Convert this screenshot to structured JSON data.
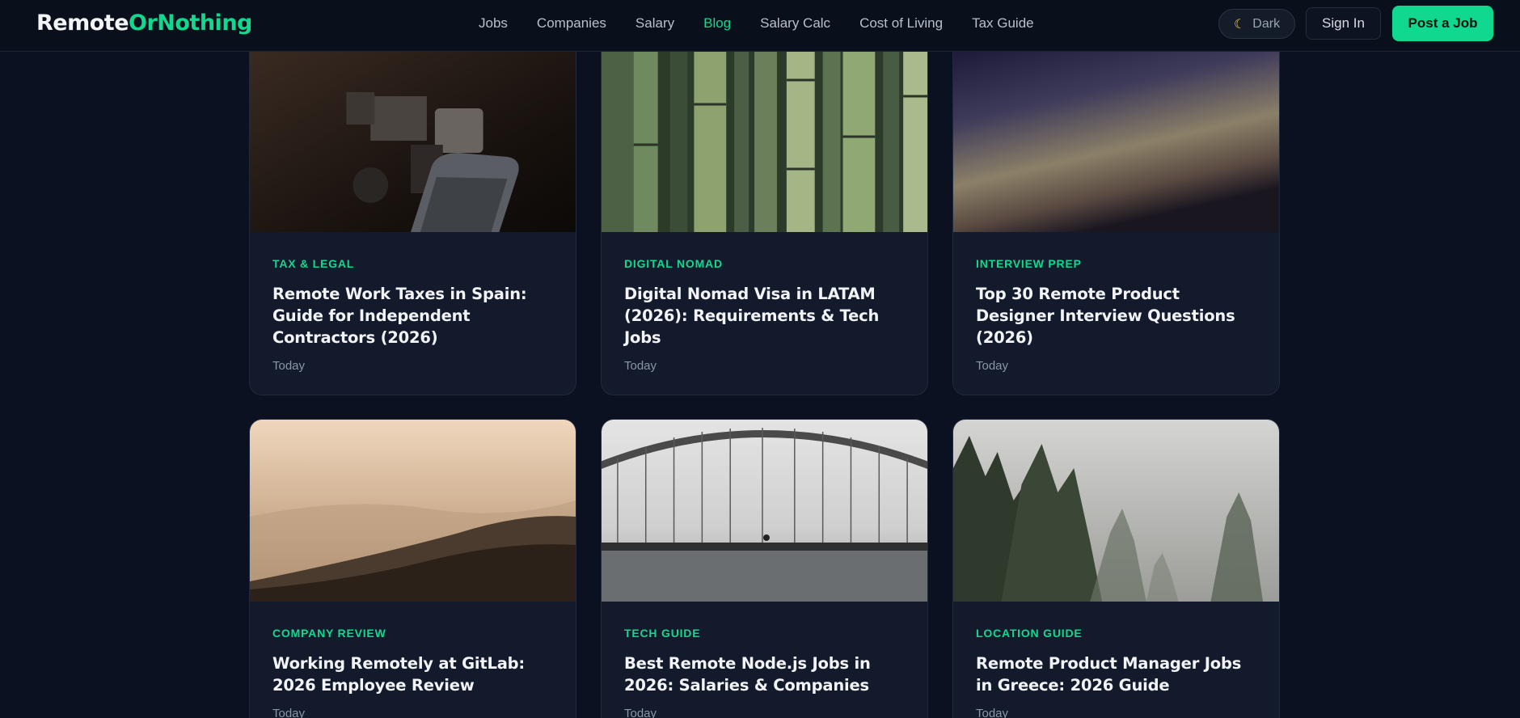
{
  "header": {
    "logo_part1": "Remote",
    "logo_part2": "OrNothing",
    "nav": [
      {
        "label": "Jobs",
        "active": false
      },
      {
        "label": "Companies",
        "active": false
      },
      {
        "label": "Salary",
        "active": false
      },
      {
        "label": "Blog",
        "active": true
      },
      {
        "label": "Salary Calc",
        "active": false
      },
      {
        "label": "Cost of Living",
        "active": false
      },
      {
        "label": "Tax Guide",
        "active": false
      }
    ],
    "theme_toggle_label": "Dark",
    "theme_icon": "moon-icon",
    "signin_label": "Sign In",
    "post_job_label": "Post a Job"
  },
  "colors": {
    "background": "#0b1120",
    "card": "#121a2b",
    "accent": "#10d98f"
  },
  "posts": [
    {
      "category": "TAX & LEGAL",
      "title": "Remote Work Taxes in Spain: Guide for Independent Contractors (2026)",
      "date": "Today",
      "image": "vintage machinery in a dark room"
    },
    {
      "category": "DIGITAL NOMAD",
      "title": "Digital Nomad Visa in LATAM (2026): Requirements & Tech Jobs",
      "date": "Today",
      "image": "bamboo stalks"
    },
    {
      "category": "INTERVIEW PREP",
      "title": "Top 30 Remote Product Designer Interview Questions (2026)",
      "date": "Today",
      "image": "twilight sky gradient"
    },
    {
      "category": "COMPANY REVIEW",
      "title": "Working Remotely at GitLab: 2026 Employee Review",
      "date": "Today",
      "image": "misty hills at sunrise"
    },
    {
      "category": "TECH GUIDE",
      "title": "Best Remote Node.js Jobs in 2026: Salaries & Companies",
      "date": "Today",
      "image": "arch bridge over water"
    },
    {
      "category": "LOCATION GUIDE",
      "title": "Remote Product Manager Jobs in Greece: 2026 Guide",
      "date": "Today",
      "image": "foggy pine forest"
    }
  ]
}
